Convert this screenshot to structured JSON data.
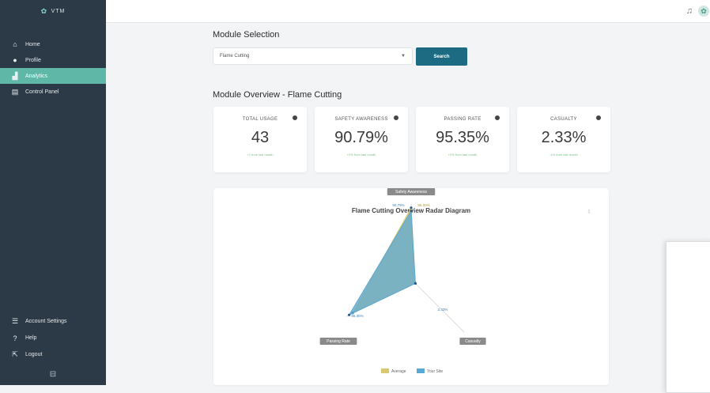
{
  "sidebar": {
    "brand": "VTM",
    "items": [
      {
        "label": "Home",
        "icon": "home-icon"
      },
      {
        "label": "Profile",
        "icon": "profile-icon"
      },
      {
        "label": "Analytics",
        "icon": "analytics-icon",
        "active": true
      },
      {
        "label": "Control Panel",
        "icon": "control-panel-icon"
      }
    ],
    "bottom_items": [
      {
        "label": "Account Settings",
        "icon": "settings-icon"
      },
      {
        "label": "Help",
        "icon": "help-icon"
      },
      {
        "label": "Logout",
        "icon": "logout-icon"
      }
    ]
  },
  "module_selection": {
    "heading": "Module Selection",
    "selected": "Flame Cutting",
    "search_label": "Search"
  },
  "overview": {
    "heading": "Module Overview - Flame Cutting",
    "cards": [
      {
        "title": "TOTAL USAGE",
        "value": "43",
        "sub": "+1 from last month"
      },
      {
        "title": "SAFETY AWARENESS",
        "value": "90.79%",
        "sub": "+2% from last month"
      },
      {
        "title": "PASSING RATE",
        "value": "95.35%",
        "sub": "+2% from last month"
      },
      {
        "title": "CASUALTY",
        "value": "2.33%",
        "sub": "-1% from last month"
      }
    ]
  },
  "chart": {
    "title": "Flame Cutting Overview Radar Diagram",
    "legend": [
      "Average",
      "Your Site"
    ],
    "colors": {
      "average": "#d8c871",
      "site": "#5aa8d6"
    }
  },
  "chart_data": {
    "type": "radar",
    "title": "Flame Cutting Overview Radar Diagram",
    "axes": [
      "Safety Awareness",
      "Casualty",
      "Passing Rate"
    ],
    "series": [
      {
        "name": "Average",
        "values": [
          95.0,
          5.0,
          90.0
        ]
      },
      {
        "name": "Your Site",
        "values": [
          90.79,
          2.33,
          95.35
        ]
      }
    ],
    "point_labels": {
      "safety_average": "95.00%",
      "safety_site": "90.79%",
      "passing_site": "95.35%",
      "casualty_site": "2.33%"
    }
  }
}
